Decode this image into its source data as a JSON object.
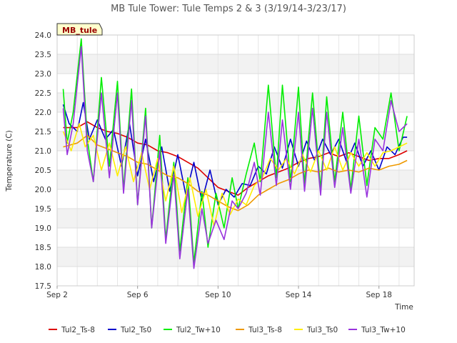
{
  "chart_data": {
    "type": "line",
    "title": "MB Tule Tower: Tule Temps 2 & 3 (3/19/14-3/23/17)",
    "xlabel": "Time",
    "ylabel": "Temperature (C)",
    "site_label": "MB_tule",
    "ylim": [
      17.5,
      24.0
    ],
    "yticks": [
      "17.5",
      "18.0",
      "18.5",
      "19.0",
      "19.5",
      "20.0",
      "20.5",
      "21.0",
      "21.5",
      "22.0",
      "22.5",
      "23.0",
      "23.5",
      "24.0"
    ],
    "xlim": [
      "Sep 2",
      "Sep 19 18:00"
    ],
    "xticks": [
      "Sep 2",
      "Sep 6",
      "Sep 10",
      "Sep 14",
      "Sep 18"
    ],
    "x_unit": "day of September",
    "grid": true,
    "legend_position": "bottom",
    "series": [
      {
        "name": "Tul2_Ts-8",
        "color": "#dd0000",
        "x": [
          2.3,
          3.0,
          3.5,
          4.0,
          4.5,
          5.0,
          5.5,
          6.0,
          6.5,
          7.0,
          7.5,
          8.0,
          8.5,
          9.0,
          9.5,
          10.0,
          10.5,
          11.0,
          11.5,
          12.0,
          12.5,
          13.0,
          13.5,
          14.0,
          14.5,
          15.0,
          15.5,
          16.0,
          16.5,
          17.0,
          17.5,
          18.0,
          18.5,
          19.0,
          19.4
        ],
        "values": [
          21.6,
          21.6,
          21.75,
          21.6,
          21.5,
          21.45,
          21.35,
          21.2,
          21.15,
          21.0,
          20.95,
          20.85,
          20.7,
          20.55,
          20.3,
          20.05,
          19.95,
          19.85,
          20.05,
          20.2,
          20.35,
          20.45,
          20.55,
          20.7,
          20.8,
          20.85,
          20.95,
          20.85,
          20.95,
          20.85,
          20.75,
          20.8,
          20.8,
          20.9,
          21.0
        ]
      },
      {
        "name": "Tul2_Ts0",
        "color": "#0000cc",
        "x": [
          2.3,
          2.6,
          3.0,
          3.3,
          3.6,
          4.0,
          4.4,
          4.8,
          5.2,
          5.6,
          6.0,
          6.4,
          6.8,
          7.2,
          7.6,
          8.0,
          8.4,
          8.8,
          9.2,
          9.6,
          10.0,
          10.4,
          10.8,
          11.2,
          11.6,
          12.0,
          12.4,
          12.8,
          13.2,
          13.6,
          14.0,
          14.4,
          14.8,
          15.2,
          15.6,
          16.0,
          16.4,
          16.8,
          17.2,
          17.6,
          18.0,
          18.4,
          18.8,
          19.2,
          19.4
        ],
        "values": [
          22.2,
          21.7,
          21.5,
          22.25,
          21.3,
          21.8,
          21.3,
          21.55,
          20.6,
          21.7,
          20.35,
          21.3,
          20.2,
          21.1,
          19.95,
          20.9,
          19.85,
          20.7,
          19.7,
          20.5,
          19.6,
          20.0,
          19.8,
          20.15,
          20.1,
          20.6,
          20.4,
          21.1,
          20.55,
          21.3,
          20.6,
          21.25,
          20.75,
          21.3,
          20.9,
          21.3,
          20.7,
          21.2,
          20.6,
          21.0,
          20.5,
          21.1,
          20.9,
          21.35,
          21.35
        ]
      },
      {
        "name": "Tul2_Tw+10",
        "color": "#00ee00",
        "x": [
          2.3,
          2.5,
          2.8,
          3.2,
          3.5,
          3.8,
          4.2,
          4.6,
          5.0,
          5.3,
          5.7,
          6.0,
          6.4,
          6.7,
          7.1,
          7.4,
          7.8,
          8.1,
          8.5,
          8.8,
          9.2,
          9.5,
          9.9,
          10.3,
          10.7,
          11.0,
          11.4,
          11.8,
          12.1,
          12.5,
          12.9,
          13.2,
          13.6,
          14.0,
          14.3,
          14.7,
          15.1,
          15.4,
          15.8,
          16.2,
          16.6,
          17.0,
          17.4,
          17.8,
          18.2,
          18.6,
          19.0,
          19.4
        ],
        "values": [
          22.6,
          21.2,
          22.0,
          23.9,
          21.3,
          20.2,
          22.9,
          20.6,
          22.8,
          20.0,
          22.6,
          19.6,
          22.1,
          19.0,
          21.4,
          18.7,
          20.7,
          18.4,
          20.3,
          18.1,
          19.95,
          18.5,
          19.9,
          19.0,
          20.3,
          19.5,
          20.4,
          21.2,
          20.2,
          22.7,
          20.3,
          22.7,
          20.2,
          22.65,
          20.15,
          22.5,
          20.0,
          22.4,
          20.2,
          22.0,
          20.0,
          21.9,
          20.1,
          21.6,
          21.3,
          22.5,
          21.0,
          21.9
        ]
      },
      {
        "name": "Tul3_Ts-8",
        "color": "#ee9900",
        "x": [
          2.3,
          3.0,
          3.5,
          4.0,
          4.5,
          5.0,
          5.5,
          6.0,
          6.5,
          7.0,
          7.5,
          8.0,
          8.5,
          9.0,
          9.5,
          10.0,
          10.5,
          11.0,
          11.5,
          12.0,
          12.5,
          13.0,
          13.5,
          14.0,
          14.5,
          15.0,
          15.5,
          16.0,
          16.5,
          17.0,
          17.5,
          18.0,
          18.5,
          19.0,
          19.4
        ],
        "values": [
          21.1,
          21.2,
          21.4,
          21.15,
          21.05,
          20.95,
          20.85,
          20.7,
          20.65,
          20.5,
          20.35,
          20.3,
          20.15,
          19.95,
          19.85,
          19.7,
          19.55,
          19.45,
          19.6,
          19.85,
          20.0,
          20.15,
          20.25,
          20.4,
          20.5,
          20.45,
          20.55,
          20.45,
          20.5,
          20.45,
          20.55,
          20.5,
          20.6,
          20.65,
          20.75
        ]
      },
      {
        "name": "Tul3_Ts0",
        "color": "#ffee00",
        "x": [
          2.3,
          2.7,
          3.1,
          3.4,
          3.8,
          4.2,
          4.6,
          5.0,
          5.4,
          5.8,
          6.2,
          6.6,
          7.0,
          7.4,
          7.8,
          8.2,
          8.6,
          9.0,
          9.4,
          9.8,
          10.2,
          10.6,
          11.0,
          11.4,
          11.8,
          12.2,
          12.6,
          13.0,
          13.4,
          13.8,
          14.2,
          14.6,
          15.0,
          15.4,
          15.8,
          16.2,
          16.6,
          17.0,
          17.4,
          17.8,
          18.2,
          18.6,
          19.0,
          19.4
        ],
        "values": [
          21.5,
          21.0,
          21.7,
          21.1,
          21.4,
          20.5,
          21.2,
          20.35,
          21.1,
          20.2,
          20.95,
          20.0,
          20.8,
          19.7,
          20.6,
          19.4,
          20.3,
          19.3,
          20.0,
          19.05,
          19.9,
          19.35,
          19.75,
          19.6,
          20.1,
          20.3,
          20.8,
          20.5,
          20.8,
          20.4,
          20.9,
          20.45,
          21.0,
          20.5,
          21.1,
          20.5,
          20.95,
          20.6,
          20.95,
          20.6,
          20.95,
          21.0,
          21.1,
          21.2
        ]
      },
      {
        "name": "Tul3_Tw+10",
        "color": "#9933dd",
        "x": [
          2.3,
          2.5,
          2.8,
          3.2,
          3.5,
          3.8,
          4.2,
          4.6,
          5.0,
          5.3,
          5.7,
          6.0,
          6.4,
          6.7,
          7.1,
          7.4,
          7.8,
          8.1,
          8.5,
          8.8,
          9.2,
          9.5,
          9.9,
          10.3,
          10.7,
          11.0,
          11.4,
          11.8,
          12.1,
          12.5,
          12.9,
          13.2,
          13.6,
          14.0,
          14.3,
          14.7,
          15.1,
          15.4,
          15.8,
          16.2,
          16.6,
          17.0,
          17.4,
          17.8,
          18.2,
          18.6,
          19.0,
          19.4
        ],
        "values": [
          22.1,
          20.9,
          21.7,
          23.7,
          21.0,
          20.2,
          22.5,
          20.3,
          22.5,
          19.9,
          22.3,
          19.6,
          21.9,
          19.0,
          21.0,
          18.6,
          20.4,
          18.2,
          20.0,
          17.95,
          19.5,
          18.6,
          19.2,
          18.7,
          19.7,
          19.5,
          19.9,
          20.7,
          19.85,
          22.0,
          20.1,
          21.8,
          20.0,
          22.0,
          19.95,
          22.1,
          19.85,
          22.0,
          20.05,
          21.6,
          19.9,
          21.3,
          19.8,
          21.3,
          21.0,
          22.3,
          21.5,
          21.7
        ]
      }
    ]
  }
}
